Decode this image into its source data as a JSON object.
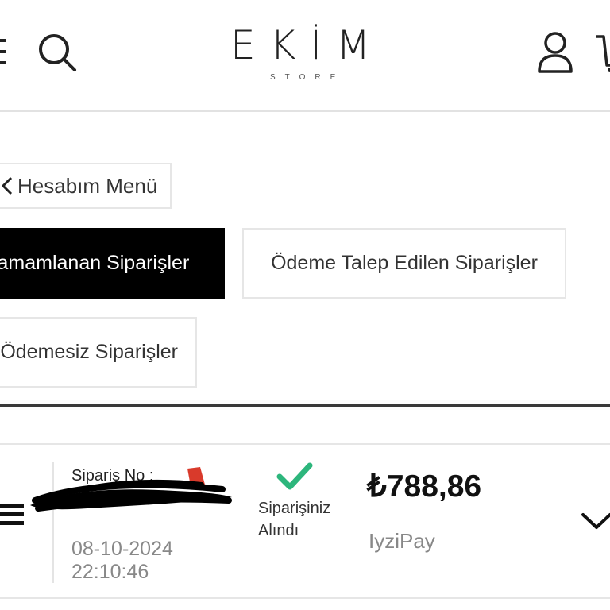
{
  "header": {
    "logo_text": "EKİM",
    "logo_subtext": "STORE"
  },
  "account_menu": {
    "label": "Hesabım Menü"
  },
  "tabs": [
    {
      "label": "Tamamlanan Siparişler",
      "active": true
    },
    {
      "label": "Ödeme Talep Edilen Siparişler",
      "active": false
    },
    {
      "label": "Ödemesiz Siparişler",
      "active": false
    }
  ],
  "order": {
    "number_label": "Sipariş No :",
    "date": "08-10-2024",
    "time": "22:10:46",
    "status": "Siparişiniz Alındı",
    "total": "₺788,86",
    "payment_method": "IyziPay"
  },
  "colors": {
    "active_tab_bg": "#000000",
    "status_check": "#2db67c",
    "border": "#e6e6e6"
  },
  "icons": [
    "menu-icon",
    "search-icon",
    "user-icon",
    "cart-icon",
    "chevron-left-icon",
    "check-icon",
    "chevron-down-icon"
  ]
}
